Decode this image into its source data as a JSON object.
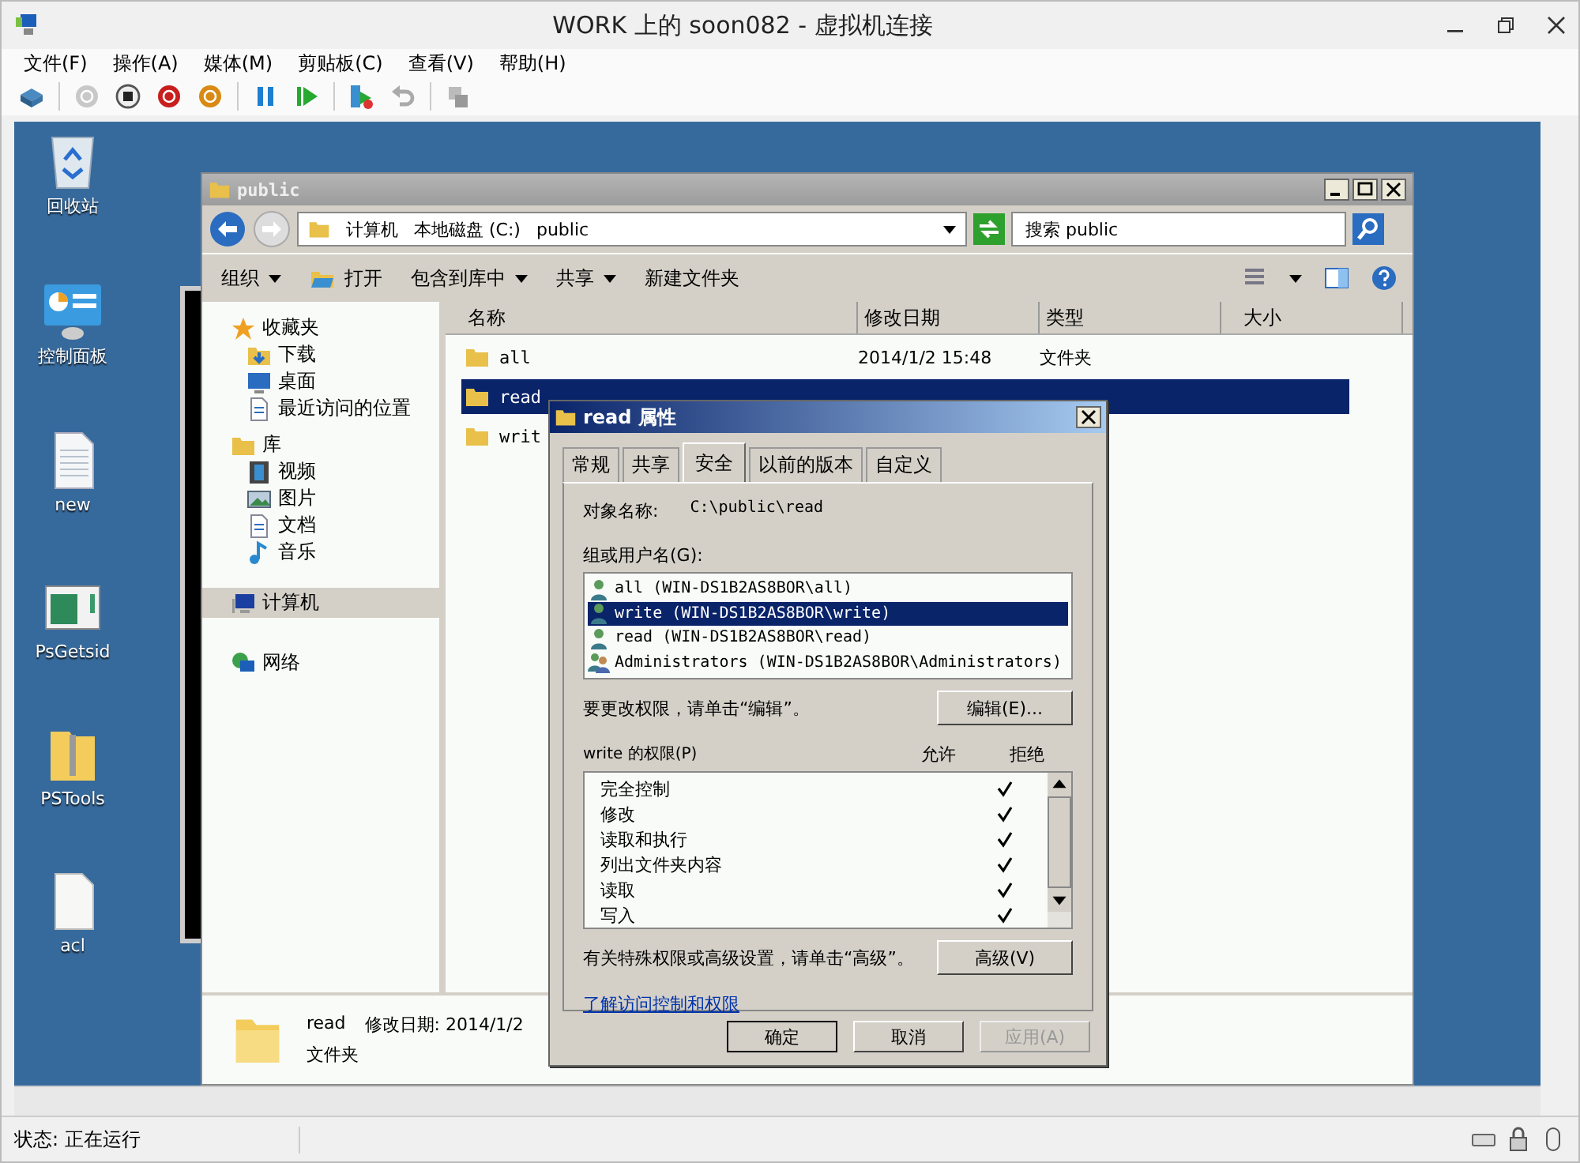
{
  "window": {
    "title": "WORK 上的 soon082 - 虚拟机连接"
  },
  "menu": [
    "文件(F)",
    "操作(A)",
    "媒体(M)",
    "剪贴板(C)",
    "查看(V)",
    "帮助(H)"
  ],
  "desktop_icons": [
    {
      "label": "回收站",
      "kind": "recycle"
    },
    {
      "label": "控制面板",
      "kind": "control"
    },
    {
      "label": "new",
      "kind": "doc"
    },
    {
      "label": "PsGetsid",
      "kind": "app"
    },
    {
      "label": "PSTools",
      "kind": "zip"
    },
    {
      "label": "acl",
      "kind": "file"
    }
  ],
  "explorer": {
    "title": "public",
    "breadcrumb": [
      "计算机",
      "本地磁盘 (C:)",
      "public"
    ],
    "search": {
      "placeholder": "搜索 public"
    },
    "toolbar": [
      {
        "label": "组织",
        "kind": "menu"
      },
      {
        "label": "打开",
        "kind": "open"
      },
      {
        "label": "包含到库中",
        "kind": "menu"
      },
      {
        "label": "共享",
        "kind": "menu"
      },
      {
        "label": "新建文件夹",
        "kind": "plain"
      }
    ],
    "nav": [
      {
        "label": "收藏夹",
        "kind": "star",
        "selected": false,
        "children": [
          {
            "label": "下载",
            "kind": "folder",
            "selected": false
          },
          {
            "label": "桌面",
            "kind": "monitor",
            "selected": false
          },
          {
            "label": "最近访问的位置",
            "kind": "doc",
            "selected": false
          }
        ]
      },
      {
        "label": "库",
        "kind": "folder",
        "selected": false,
        "children": [
          {
            "label": "视频",
            "kind": "film",
            "selected": false
          },
          {
            "label": "图片",
            "kind": "image",
            "selected": false
          },
          {
            "label": "文档",
            "kind": "doc",
            "selected": false
          },
          {
            "label": "音乐",
            "kind": "note",
            "selected": false
          }
        ]
      },
      {
        "label": "计算机",
        "kind": "monitor",
        "selected": true
      },
      {
        "label": "网络",
        "kind": "globe",
        "selected": false
      }
    ],
    "columns": [
      "名称",
      "修改日期",
      "类型",
      "大小"
    ],
    "files": [
      {
        "name": "all",
        "date": "2014/1/2 15:48",
        "type": "文件夹",
        "selected": false
      },
      {
        "name": "read",
        "selected": true
      },
      {
        "name": "writ",
        "selected": false
      }
    ],
    "details": {
      "name": "read",
      "date": "修改日期: 2014/1/2",
      "type": "文件夹"
    }
  },
  "dialog": {
    "title": "read 属性",
    "tabs": [
      {
        "label": "常规",
        "selected": false
      },
      {
        "label": "共享",
        "selected": false
      },
      {
        "label": "安全",
        "selected": true
      },
      {
        "label": "以前的版本",
        "selected": false
      },
      {
        "label": "自定义",
        "selected": false
      }
    ],
    "object_label": "对象名称:",
    "object_value": "C:\\public\\read",
    "groups_label": "组或用户名(G):",
    "groups": [
      {
        "name": "all (WIN-DS1B2AS8BOR\\all)",
        "kind": "user",
        "selected": false
      },
      {
        "name": "write (WIN-DS1B2AS8BOR\\write)",
        "kind": "user",
        "selected": true
      },
      {
        "name": "read (WIN-DS1B2AS8BOR\\read)",
        "kind": "user",
        "selected": false
      },
      {
        "name": "Administrators (WIN-DS1B2AS8BOR\\Administrators)",
        "kind": "group",
        "selected": false
      }
    ],
    "edit_hint": "要更改权限，请单击“编辑”。",
    "edit_button": "编辑(E)...",
    "perm_label": "write 的权限(P)",
    "allow": "允许",
    "deny": "拒绝",
    "permissions": [
      {
        "name": "完全控制",
        "allow": false,
        "deny": true
      },
      {
        "name": "修改",
        "allow": false,
        "deny": true
      },
      {
        "name": "读取和执行",
        "allow": false,
        "deny": true
      },
      {
        "name": "列出文件夹内容",
        "allow": false,
        "deny": true
      },
      {
        "name": "读取",
        "allow": false,
        "deny": true
      },
      {
        "name": "写入",
        "allow": false,
        "deny": true
      }
    ],
    "advanced_hint": "有关特殊权限或高级设置，请单击“高级”。",
    "advanced_button": "高级(V)",
    "link": "了解访问控制和权限",
    "buttons": [
      {
        "label": "确定",
        "disabled": false
      },
      {
        "label": "取消",
        "disabled": false
      },
      {
        "label": "应用(A)",
        "disabled": true
      }
    ]
  },
  "status": "状态: 正在运行"
}
